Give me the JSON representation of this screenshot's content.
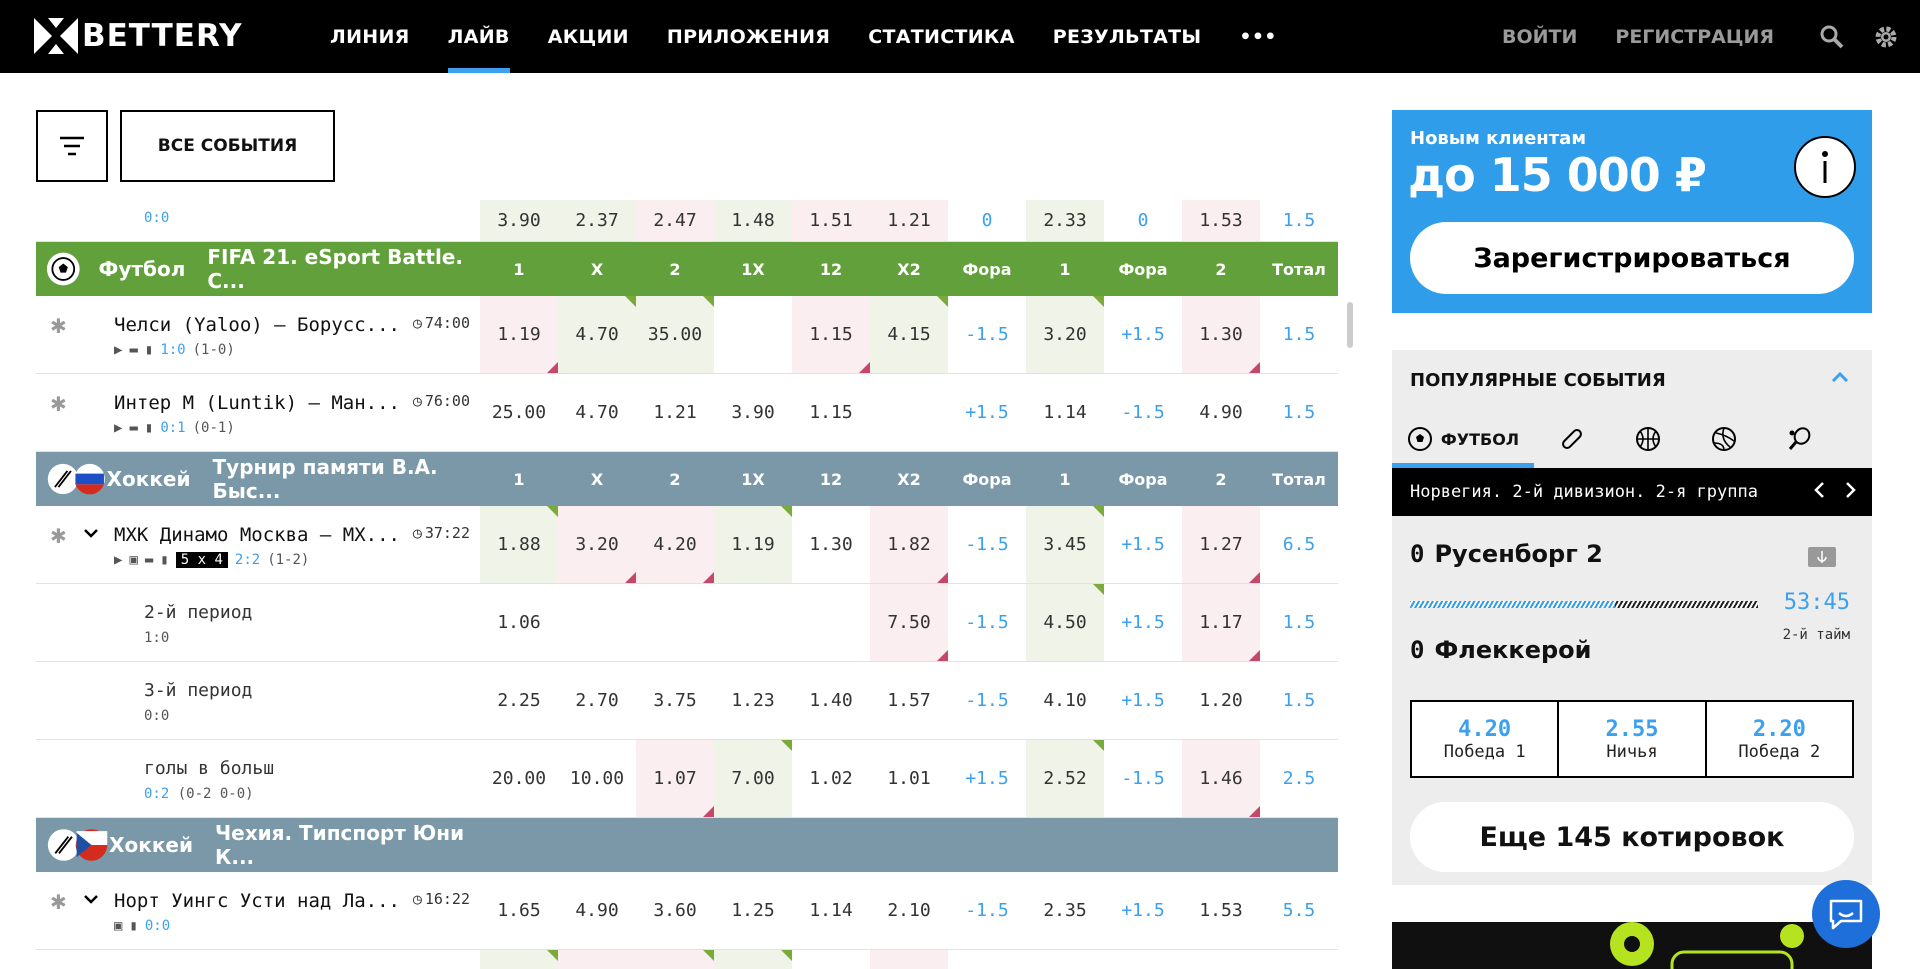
{
  "header": {
    "logo": "BETTERY",
    "nav": [
      "ЛИНИЯ",
      "ЛАЙВ",
      "АКЦИИ",
      "ПРИЛОЖЕНИЯ",
      "СТАТИСТИКА",
      "РЕЗУЛЬТАТЫ"
    ],
    "more": "•••",
    "login": "ВОЙТИ",
    "register": "РЕГИСТРАЦИЯ"
  },
  "filter": {
    "all_events": "ВСЕ СОБЫТИЯ"
  },
  "columns": [
    "1",
    "X",
    "2",
    "1X",
    "12",
    "X2",
    "Фора",
    "1",
    "Фора",
    "2",
    "Тотал"
  ],
  "table": {
    "r0": {
      "score": "0:0",
      "odds": [
        "3.90",
        "2.37",
        "2.47",
        "1.48",
        "1.51",
        "1.21",
        "0",
        "2.33",
        "0",
        "1.53",
        "1.5"
      ]
    },
    "h1": {
      "sport": "Футбол",
      "league": "FIFA 21. eSport Battle. С..."
    },
    "r1": {
      "name": "Челси (Yaloo) — Борусс...",
      "time": "74:00",
      "score": "1:0",
      "detail": "(1-0)",
      "odds": [
        "1.19",
        "4.70",
        "35.00",
        "",
        "1.15",
        "4.15",
        "-1.5",
        "3.20",
        "+1.5",
        "1.30",
        "1.5"
      ]
    },
    "r2": {
      "name": "Интер М (Luntik) — Ман...",
      "time": "76:00",
      "score": "0:1",
      "detail": "(0-1)",
      "odds": [
        "25.00",
        "4.70",
        "1.21",
        "3.90",
        "1.15",
        "",
        "+1.5",
        "1.14",
        "-1.5",
        "4.90",
        "1.5"
      ]
    },
    "h2": {
      "sport": "Хоккей",
      "league": "Турнир памяти В.А. Быс..."
    },
    "r3": {
      "name": "МХК Динамо Москва — МХ...",
      "time": "37:22",
      "badge": "5 x 4",
      "score": "2:2",
      "detail": "(1-2)",
      "odds": [
        "1.88",
        "3.20",
        "4.20",
        "1.19",
        "1.30",
        "1.82",
        "-1.5",
        "3.45",
        "+1.5",
        "1.27",
        "6.5"
      ]
    },
    "r4": {
      "name": "2-й период",
      "score": "1:0",
      "odds": [
        "1.06",
        "",
        "",
        "",
        "",
        "7.50",
        "-1.5",
        "4.50",
        "+1.5",
        "1.17",
        "1.5"
      ]
    },
    "r5": {
      "name": "3-й период",
      "score": "0:0",
      "odds": [
        "2.25",
        "2.70",
        "3.75",
        "1.23",
        "1.40",
        "1.57",
        "-1.5",
        "4.10",
        "+1.5",
        "1.20",
        "1.5"
      ]
    },
    "r6": {
      "name": "голы в больш",
      "score": "0:2",
      "detail": "(0-2 0-0)",
      "odds": [
        "20.00",
        "10.00",
        "1.07",
        "7.00",
        "1.02",
        "1.01",
        "+1.5",
        "2.52",
        "-1.5",
        "1.46",
        "2.5"
      ]
    },
    "h3": {
      "sport": "Хоккей",
      "league": "Чехия. Типспорт Юни К..."
    },
    "r7": {
      "name": "Норт Уингс Усти над Ла...",
      "time": "16:22",
      "score": "0:0",
      "odds": [
        "1.65",
        "4.90",
        "3.60",
        "1.25",
        "1.14",
        "2.10",
        "-1.5",
        "2.35",
        "+1.5",
        "1.53",
        "5.5"
      ]
    }
  },
  "promo": {
    "line1": "Новым клиентам",
    "line2": "до 15 000 ₽",
    "button": "Зарегистрироваться"
  },
  "popular": {
    "title": "ПОПУЛЯРНЫЕ СОБЫТИЯ",
    "tab_football": "ФУТБОЛ",
    "league": "Норвегия. 2-й дивизион. 2-я группа",
    "team1_score": "0",
    "team1": "Русенборг 2",
    "team2_score": "0",
    "team2": "Флеккерой",
    "time": "53:45",
    "period": "2-й тайм",
    "progress": 0.59,
    "odds": [
      {
        "v": "4.20",
        "k": "Победа 1"
      },
      {
        "v": "2.55",
        "k": "Ничья"
      },
      {
        "v": "2.20",
        "k": "Победа 2"
      }
    ],
    "more": "Еще 145 котировок"
  },
  "colors": {
    "accent": "#3ba0ee",
    "football_header": "#62a03b",
    "hockey_header": "#7a98a8",
    "promo": "#2f9de9"
  }
}
